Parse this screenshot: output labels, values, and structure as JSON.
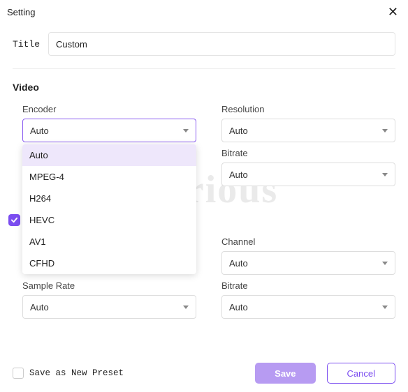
{
  "header": {
    "title": "Setting"
  },
  "title": {
    "label": "Title",
    "value": "Custom"
  },
  "sections": {
    "video": "Video"
  },
  "video": {
    "encoder": {
      "label": "Encoder",
      "value": "Auto",
      "options": [
        "Auto",
        "MPEG-4",
        "H264",
        "HEVC",
        "AV1",
        "CFHD"
      ]
    },
    "resolution": {
      "label": "Resolution",
      "value": "Auto"
    },
    "bitrate": {
      "label": "Bitrate",
      "value": "Auto"
    }
  },
  "audio": {
    "channel": {
      "label": "Channel",
      "value": "Auto"
    },
    "sample_rate": {
      "label": "Sample Rate",
      "value": "Auto"
    },
    "bitrate": {
      "label": "Bitrate",
      "value": "Auto"
    }
  },
  "preset": {
    "label": "Save as New Preset",
    "checked": false
  },
  "buttons": {
    "save": "Save",
    "cancel": "Cancel"
  },
  "watermark": "Dealarious"
}
